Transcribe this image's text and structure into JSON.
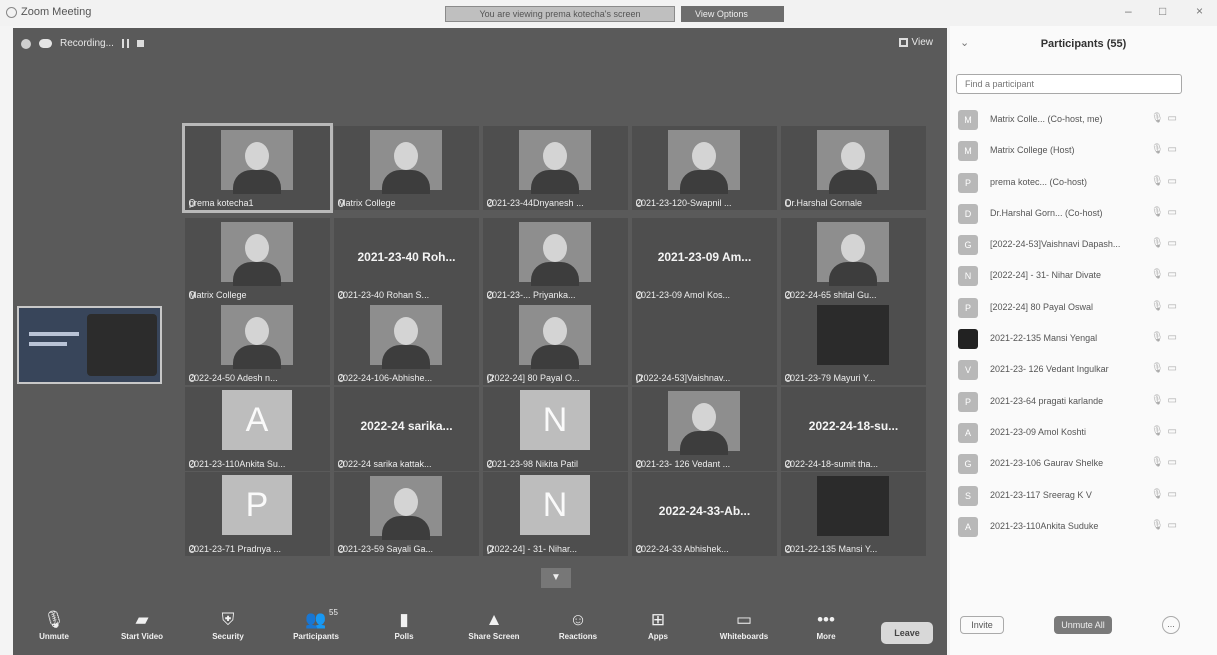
{
  "window": {
    "app_title": "Zoom Meeting",
    "share_banner": "You are viewing prema kotecha's screen",
    "view_options": "View Options",
    "controls": [
      "–",
      "□",
      "×"
    ]
  },
  "meeting": {
    "recording_label": "Recording...",
    "view_label": "View",
    "page_down_icon": "chevron-down-icon"
  },
  "tiles": [
    {
      "kind": "photo",
      "name": "prema kotecha1",
      "active": true
    },
    {
      "kind": "photo",
      "name": "Matrix College"
    },
    {
      "kind": "photo",
      "name": "2021-23-44Dnyanesh ..."
    },
    {
      "kind": "photo",
      "name": "2021-23-120-Swapnil ..."
    },
    {
      "kind": "photo",
      "name": "Dr.Harshal Gornale"
    },
    {
      "kind": "photo",
      "name": "Matrix College"
    },
    {
      "kind": "text",
      "big": "2021-23-40 Roh...",
      "name": "2021-23-40 Rohan S..."
    },
    {
      "kind": "photo",
      "name": "2021-23-... Priyanka..."
    },
    {
      "kind": "text",
      "big": "2021-23-09 Am...",
      "name": "2021-23-09 Amol Kos..."
    },
    {
      "kind": "photo",
      "name": "2022-24-65 shital Gu..."
    },
    {
      "kind": "photo",
      "name": "2022-24-50 Adesh n..."
    },
    {
      "kind": "photo",
      "name": "2022-24-106-Abhishe..."
    },
    {
      "kind": "photo",
      "name": "[2022-24] 80 Payal O..."
    },
    {
      "kind": "blank",
      "name": "[2022-24-53]Vaishnav..."
    },
    {
      "kind": "dark",
      "name": "2021-23-79 Mayuri Y..."
    },
    {
      "kind": "avatar",
      "letter": "A",
      "name": "2021-23-110Ankita Su..."
    },
    {
      "kind": "text",
      "big": "2022-24 sarika...",
      "name": "2022-24 sarika kattak..."
    },
    {
      "kind": "avatar",
      "letter": "N",
      "name": "2021-23-98 Nikita Patil"
    },
    {
      "kind": "photo",
      "name": "2021-23- 126 Vedant ..."
    },
    {
      "kind": "text",
      "big": "2022-24-18-su...",
      "name": "2022-24-18-sumit tha..."
    },
    {
      "kind": "avatar",
      "letter": "P",
      "name": "2021-23-71 Pradnya ..."
    },
    {
      "kind": "photo",
      "name": "2021-23-59 Sayali Ga..."
    },
    {
      "kind": "avatar",
      "letter": "N",
      "name": "[2022-24] - 31- Nihar..."
    },
    {
      "kind": "text",
      "big": "2022-24-33-Ab...",
      "name": "2022-24-33 Abhishek..."
    },
    {
      "kind": "dark",
      "name": "2021-22-135 Mansi Y..."
    }
  ],
  "toolbar": {
    "buttons": [
      {
        "icon": "microphone-icon",
        "glyph": "🎙",
        "label": "Unmute"
      },
      {
        "icon": "video-icon",
        "glyph": "▰",
        "label": "Start Video"
      },
      {
        "icon": "shield-icon",
        "glyph": "⛨",
        "label": "Security"
      },
      {
        "icon": "participants-icon",
        "glyph": "👥",
        "label": "Participants",
        "badge": "55"
      },
      {
        "icon": "polls-icon",
        "glyph": "▮",
        "label": "Polls"
      },
      {
        "icon": "share-screen-icon",
        "glyph": "▲",
        "label": "Share Screen"
      },
      {
        "icon": "reactions-icon",
        "glyph": "☺",
        "label": "Reactions"
      },
      {
        "icon": "apps-icon",
        "glyph": "⊞",
        "label": "Apps"
      },
      {
        "icon": "whiteboard-icon",
        "glyph": "▭",
        "label": "Whiteboards"
      },
      {
        "icon": "more-icon",
        "glyph": "•••",
        "label": "More"
      }
    ],
    "leave_label": "Leave"
  },
  "participants": {
    "title": "Participants (55)",
    "search_placeholder": "Find a participant",
    "list": [
      {
        "name": "Matrix Colle... (Co-host, me)",
        "avatar": "M"
      },
      {
        "name": "Matrix College (Host)",
        "avatar": "M"
      },
      {
        "name": "prema kotec... (Co-host)",
        "avatar": "P"
      },
      {
        "name": "Dr.Harshal Gorn... (Co-host)",
        "avatar": "D"
      },
      {
        "name": "[2022-24-53]Vaishnavi Dapash...",
        "avatar": "G"
      },
      {
        "name": "[2022-24] - 31- Nihar Divate",
        "avatar": "N"
      },
      {
        "name": "[2022-24] 80 Payal Oswal",
        "avatar": "P"
      },
      {
        "name": "2021-22-135 Mansi Yengal",
        "avatar": "",
        "dark": true
      },
      {
        "name": "2021-23- 126 Vedant Ingulkar",
        "avatar": "V"
      },
      {
        "name": "2021-23-64 pragati karlande",
        "avatar": "P"
      },
      {
        "name": "2021-23-09 Amol Koshti",
        "avatar": "A"
      },
      {
        "name": "2021-23-106 Gaurav Shelke",
        "avatar": "G"
      },
      {
        "name": "2021-23-117 Sreerag K V",
        "avatar": "S"
      },
      {
        "name": "2021-23-110Ankita Suduke",
        "avatar": "A"
      }
    ],
    "invite_label": "Invite",
    "mute_all_label": "Unmute All",
    "more_label": "..."
  }
}
